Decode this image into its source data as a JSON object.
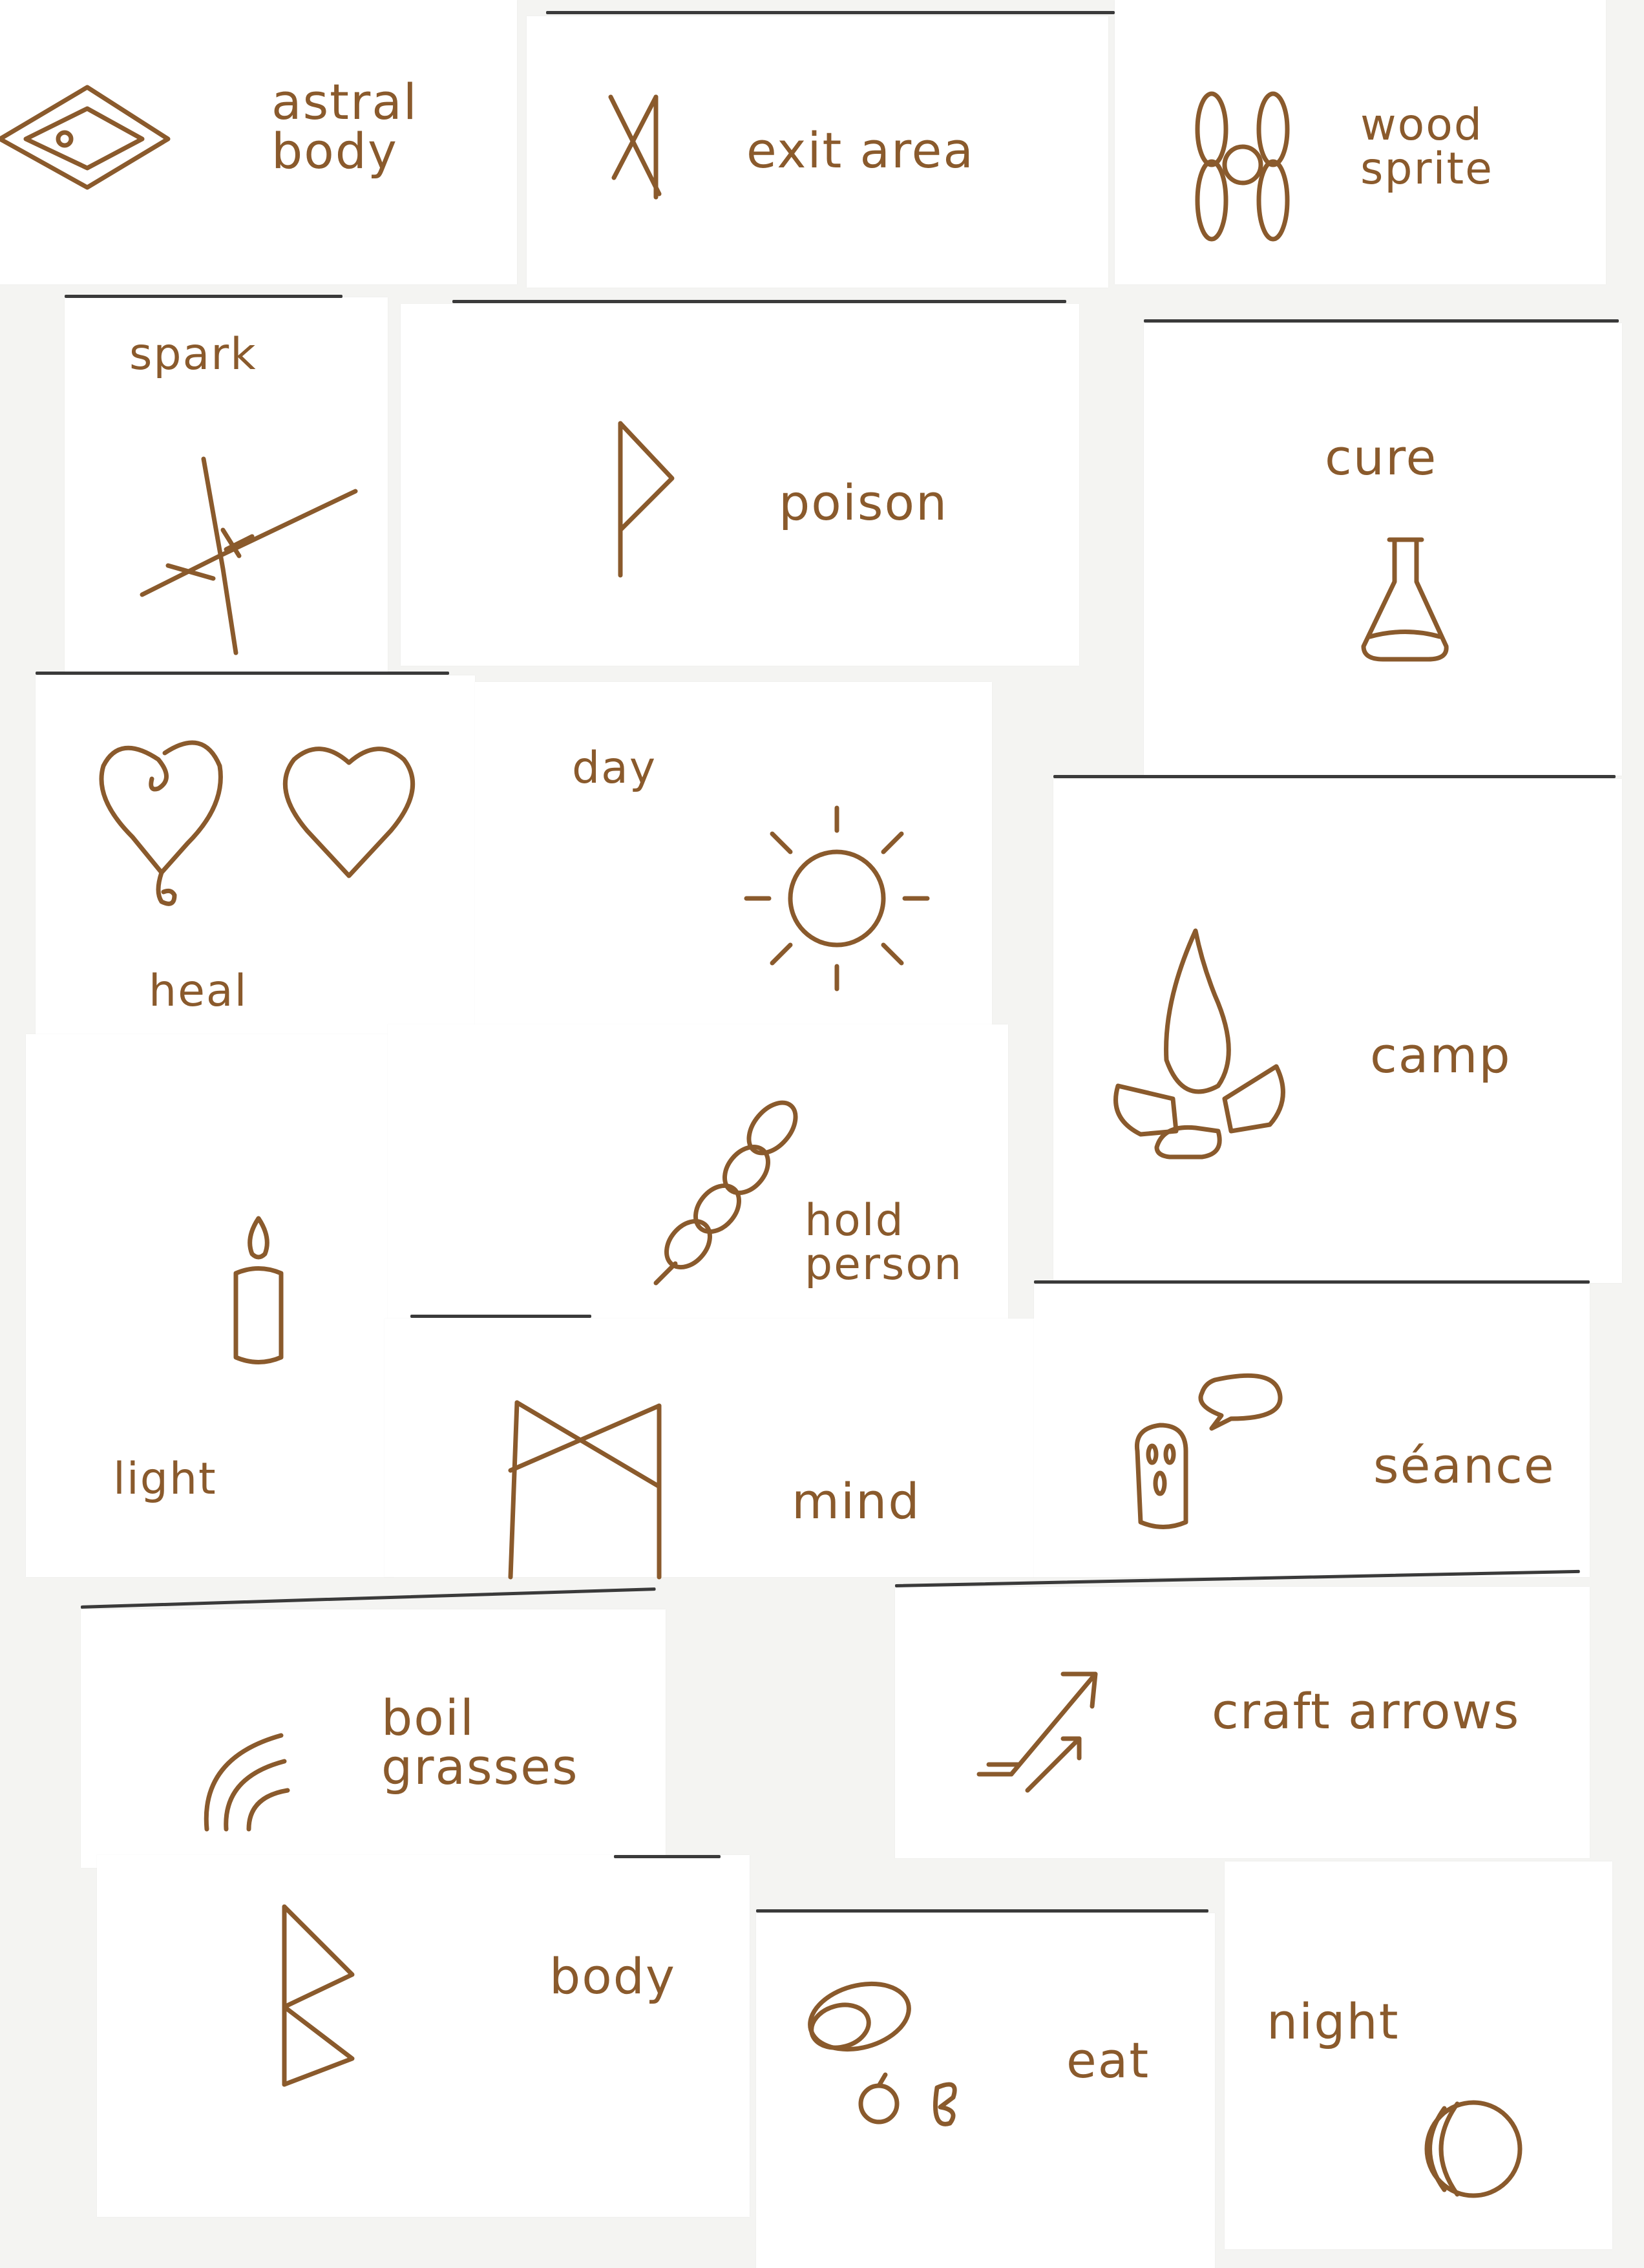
{
  "ink_color": "#8a5a2c",
  "cards": [
    {
      "id": "astral-body",
      "label": "astral\nbody",
      "icon": "nested-diamond-icon"
    },
    {
      "id": "exit-area",
      "label": "exit area",
      "icon": "exit-rune-icon"
    },
    {
      "id": "wood-sprite",
      "label": "wood\nsprite",
      "icon": "wood-sprite-knot-icon"
    },
    {
      "id": "spark",
      "label": "spark",
      "icon": "spark-icon"
    },
    {
      "id": "poison",
      "label": "poison",
      "icon": "wunjo-rune-icon"
    },
    {
      "id": "cure",
      "label": "cure",
      "icon": "flask-icon"
    },
    {
      "id": "heal",
      "label": "heal",
      "icon": "heart-icon"
    },
    {
      "id": "day",
      "label": "day",
      "icon": "sun-icon"
    },
    {
      "id": "camp",
      "label": "camp",
      "icon": "campfire-icon"
    },
    {
      "id": "light",
      "label": "light",
      "icon": "candle-icon"
    },
    {
      "id": "hold-person",
      "label": "hold\nperson",
      "icon": "chain-icon"
    },
    {
      "id": "mind",
      "label": "mind",
      "icon": "mind-rune-icon"
    },
    {
      "id": "seance",
      "label": "séance",
      "icon": "ghost-speech-icon"
    },
    {
      "id": "boil-grasses",
      "label": "boil\ngrasses",
      "icon": "steam-arcs-icon"
    },
    {
      "id": "craft-arrows",
      "label": "craft arrows",
      "icon": "arrows-icon"
    },
    {
      "id": "body",
      "label": "body",
      "icon": "berkano-rune-icon"
    },
    {
      "id": "eat",
      "label": "eat",
      "icon": "food-icon"
    },
    {
      "id": "night",
      "label": "night",
      "icon": "crescent-moon-icon"
    }
  ]
}
